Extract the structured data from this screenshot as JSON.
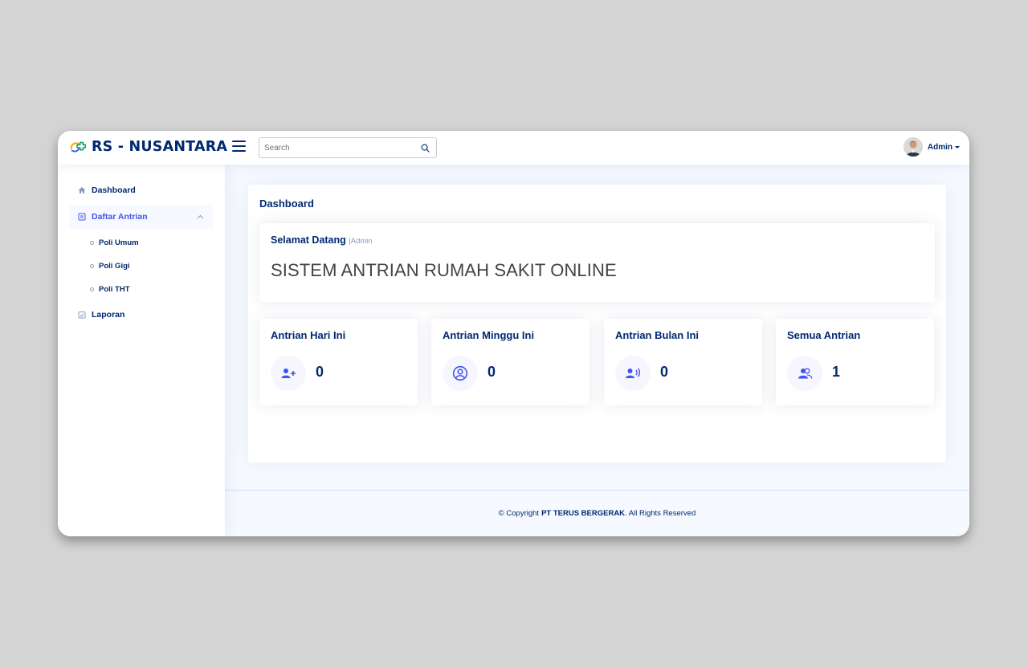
{
  "brand": {
    "name": "RS - NUSANTARA"
  },
  "search": {
    "placeholder": "Search"
  },
  "profile": {
    "name": "Admin"
  },
  "sidebar": {
    "items": [
      {
        "label": "Dashboard",
        "icon": "home-icon"
      },
      {
        "label": "Daftar Antrian",
        "icon": "list-icon",
        "expanded": true,
        "children": [
          {
            "label": "Poli Umum"
          },
          {
            "label": "Poli Gigi"
          },
          {
            "label": "Poli THT"
          }
        ]
      },
      {
        "label": "Laporan",
        "icon": "report-icon"
      }
    ]
  },
  "main": {
    "title": "Dashboard",
    "welcome": {
      "greeting": "Selamat Datang",
      "separator": "|",
      "user": "Admin",
      "headline": "SISTEM ANTRIAN RUMAH SAKIT ONLINE"
    },
    "cards": [
      {
        "title": "Antrian Hari Ini",
        "value": "0",
        "icon": "user-plus-icon"
      },
      {
        "title": "Antrian Minggu Ini",
        "value": "0",
        "icon": "user-circle-icon"
      },
      {
        "title": "Antrian Bulan Ini",
        "value": "0",
        "icon": "user-voice-icon"
      },
      {
        "title": "Semua Antrian",
        "value": "1",
        "icon": "users-icon"
      }
    ]
  },
  "footer": {
    "prefix": "© Copyright",
    "company": "PT TERUS BERGERAK",
    "suffix": ". All Rights Reserved"
  },
  "colors": {
    "primary": "#012970",
    "accent": "#4154f1",
    "background": "#f6f9ff"
  }
}
